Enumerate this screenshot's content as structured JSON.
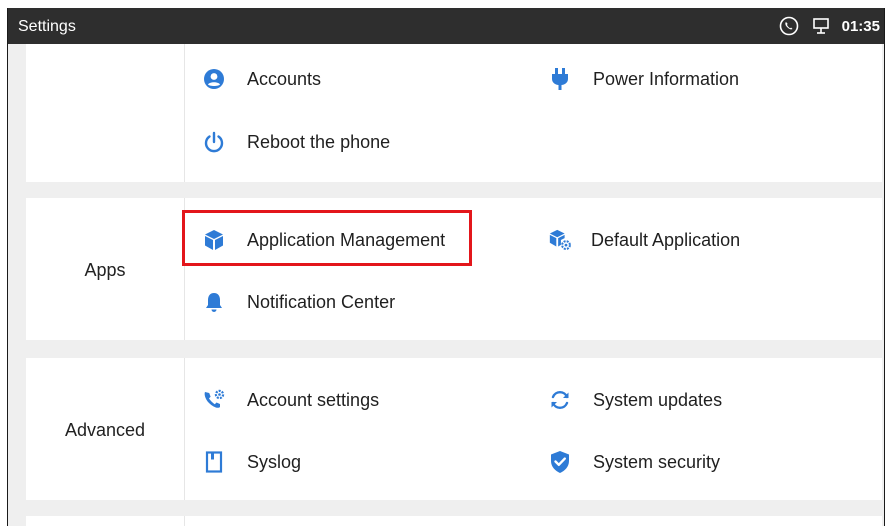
{
  "topbar": {
    "title": "Settings",
    "time": "01:35",
    "icons": [
      "phone-call-icon",
      "network-icon"
    ]
  },
  "colors": {
    "accent": "#2e7bd6",
    "topbar_bg": "#2e2e2e",
    "page_bg": "#efefef",
    "highlight": "#e3161b"
  },
  "sections": {
    "top": {
      "label": "",
      "items": [
        {
          "label": "Accounts",
          "icon": "account-icon"
        },
        {
          "label": "Power Information",
          "icon": "power-plug-icon"
        },
        {
          "label": "Reboot the phone",
          "icon": "power-icon"
        }
      ]
    },
    "apps": {
      "label": "Apps",
      "items": [
        {
          "label": "Application Management",
          "icon": "cube-icon"
        },
        {
          "label": "Default Application",
          "icon": "cube-gear-icon"
        },
        {
          "label": "Notification Center",
          "icon": "bell-icon"
        }
      ]
    },
    "advanced": {
      "label": "Advanced",
      "items": [
        {
          "label": "Account settings",
          "icon": "phone-settings-icon"
        },
        {
          "label": "System updates",
          "icon": "sync-icon"
        },
        {
          "label": "Syslog",
          "icon": "document-icon"
        },
        {
          "label": "System security",
          "icon": "shield-check-icon"
        }
      ]
    }
  }
}
